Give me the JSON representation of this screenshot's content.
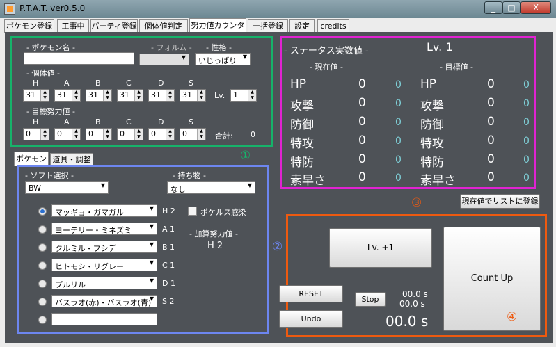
{
  "window": {
    "title": "P.T.A.T. ver0.5.0",
    "min": "_",
    "max": "□",
    "close": "X"
  },
  "tabs": [
    "ポケモン登録",
    "工事中",
    "パーティ登録",
    "個体値判定",
    "努力値カウンタ",
    "一括登録",
    "設定",
    "credits"
  ],
  "top": {
    "pokemon_name_label": "- ポケモン名 -",
    "form_label": "- フォルム -",
    "nature_label": "- 性格 -",
    "nature_value": "いじっぱり",
    "iv_label": "- 個体値 -",
    "stat_letters": [
      "H",
      "A",
      "B",
      "C",
      "D",
      "S"
    ],
    "iv_values": [
      "31",
      "31",
      "31",
      "31",
      "31",
      "31"
    ],
    "lv_label": "Lv.",
    "lv_value": "1",
    "target_ev_label": "- 目標努力値 -",
    "ev_values": [
      "0",
      "0",
      "0",
      "0",
      "0",
      "0"
    ],
    "total_label": "合計:",
    "total_value": "0",
    "marker": "①"
  },
  "subtabs": [
    "ポケモン",
    "道具・調整"
  ],
  "left": {
    "soft_label": "- ソフト選択 -",
    "soft_value": "BW",
    "held_label": "- 持ち物 -",
    "held_value": "なし",
    "rows": [
      {
        "name": "マッギョ・ガマガル",
        "stat": "H 2"
      },
      {
        "name": "ヨーテリー・ミネズミ",
        "stat": "A 1"
      },
      {
        "name": "クルミル・フシデ",
        "stat": "B 1"
      },
      {
        "name": "ヒトモシ・リグレー",
        "stat": "C 1"
      },
      {
        "name": "プルリル",
        "stat": "D 1"
      },
      {
        "name": "バスラオ(赤)・バスラオ(青)",
        "stat": "S 2"
      }
    ],
    "pokerus_label": "ポケルス感染",
    "add_ev_label": "- 加算努力値 -",
    "add_ev_value": "H 2",
    "marker": "②"
  },
  "status": {
    "title": "- ステータス実数値 -",
    "level": "Lv. 1",
    "current_label": "- 現在値 -",
    "target_label": "- 目標値 -",
    "rows": [
      {
        "name": "HP",
        "cur": "0",
        "cur_ev": "0",
        "tname": "HP",
        "tgt": "0",
        "tgt_ev": "0"
      },
      {
        "name": "攻撃",
        "cur": "0",
        "cur_ev": "0",
        "tname": "攻撃",
        "tgt": "0",
        "tgt_ev": "0"
      },
      {
        "name": "防御",
        "cur": "0",
        "cur_ev": "0",
        "tname": "防御",
        "tgt": "0",
        "tgt_ev": "0"
      },
      {
        "name": "特攻",
        "cur": "0",
        "cur_ev": "0",
        "tname": "特攻",
        "tgt": "0",
        "tgt_ev": "0"
      },
      {
        "name": "特防",
        "cur": "0",
        "cur_ev": "0",
        "tname": "特防",
        "tgt": "0",
        "tgt_ev": "0"
      },
      {
        "name": "素早さ",
        "cur": "0",
        "cur_ev": "0",
        "tname": "素早さ",
        "tgt": "0",
        "tgt_ev": "0"
      }
    ],
    "marker": "③",
    "register_label": "現在値でリストに登録"
  },
  "counter": {
    "lv_btn": "Lv. +1",
    "count_btn": "Count Up",
    "reset": "RESET",
    "undo": "Undo",
    "stop": "Stop",
    "time1": "00.0 s",
    "time2": "00.0 s",
    "time_main": "00.0 s",
    "marker": "④"
  },
  "colors": {
    "green": "#16b36a",
    "blue": "#6d86f0",
    "magenta": "#e023d2",
    "orange": "#ee5a10"
  }
}
